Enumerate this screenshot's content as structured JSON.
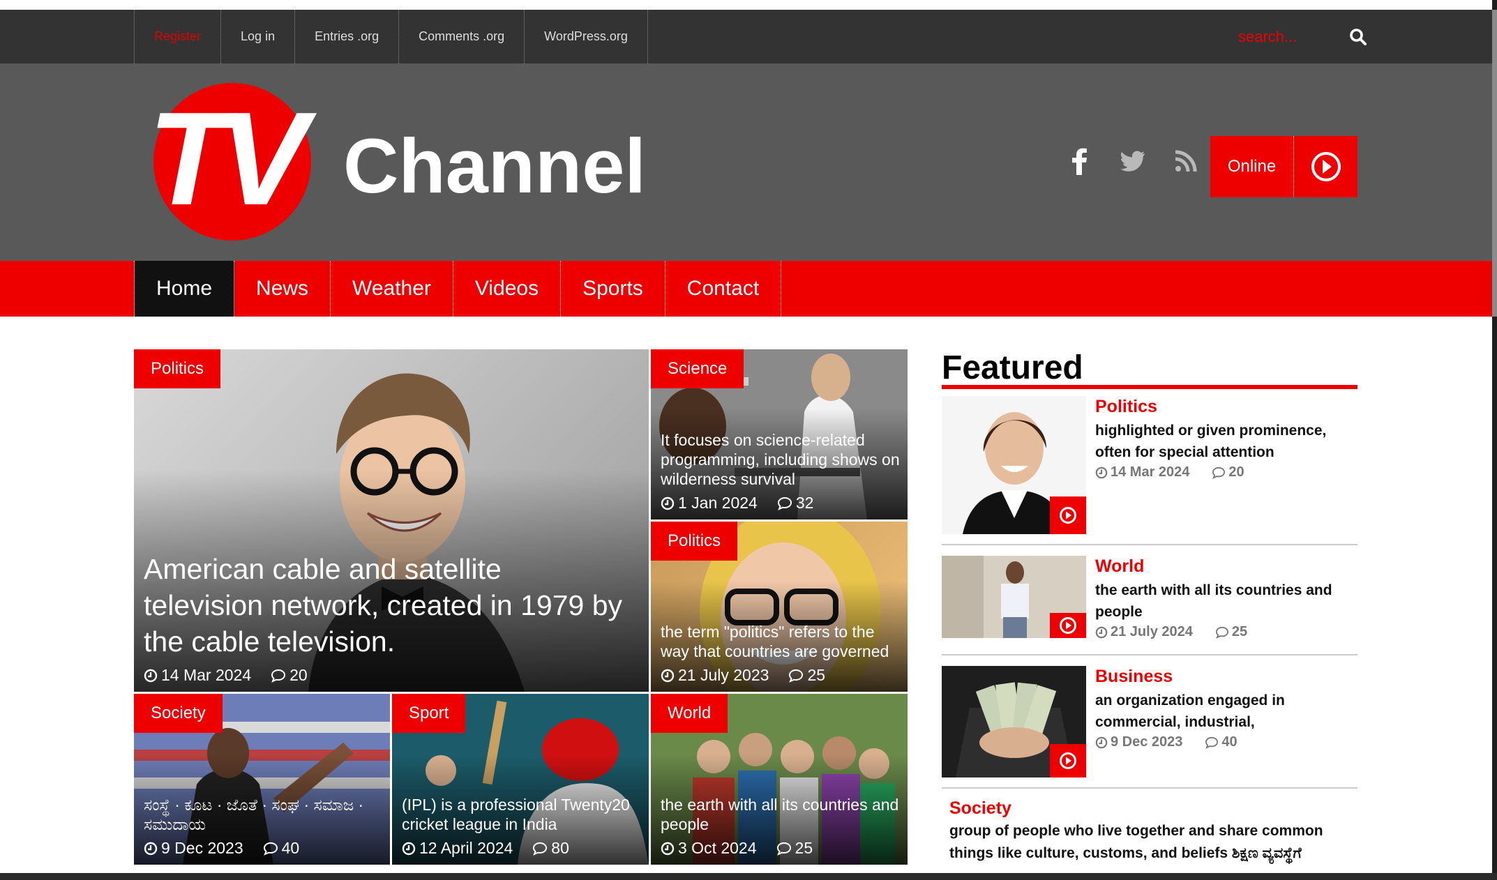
{
  "topbar": {
    "links": [
      "Register",
      "Log in",
      "Entries .org",
      "Comments .org",
      "WordPress.org"
    ],
    "search_placeholder": "search..."
  },
  "header": {
    "logo_text": "TV",
    "site_name": "Channel",
    "social": [
      "facebook-icon",
      "twitter-icon",
      "rss-icon"
    ],
    "online_label": "Online"
  },
  "nav": {
    "items": [
      "Home",
      "News",
      "Weather",
      "Videos",
      "Sports",
      "Contact"
    ],
    "active": "Home"
  },
  "grid": {
    "main": {
      "category": "Politics",
      "caption": "American cable and satellite television network, created in 1979 by the cable television.",
      "date": "14 Mar 2024",
      "comments": "20"
    },
    "science": {
      "category": "Science",
      "caption": "It focuses on science-related programming, including shows on wilderness survival",
      "date": "1 Jan 2024",
      "comments": "32"
    },
    "politics2": {
      "category": "Politics",
      "caption": "the term \"politics\" refers to the way that countries are governed",
      "date": "21 July 2023",
      "comments": "25"
    },
    "society": {
      "category": "Society",
      "caption": "ಸಂಸ್ಥೆ · ಕೂಟ · ಜೊತೆ · ಸಂಘ · ಸಮಾಜ · ಸಮುದಾಯ",
      "date": "9 Dec 2023",
      "comments": "40"
    },
    "sport": {
      "category": "Sport",
      "caption": "(IPL) is a professional Twenty20 cricket league in India",
      "date": "12 April 2024",
      "comments": "80"
    },
    "world": {
      "category": "World",
      "caption": "the earth with all its countries and people",
      "date": "3 Oct 2024",
      "comments": "25"
    }
  },
  "featured": {
    "title": "Featured",
    "items": [
      {
        "category": "Politics",
        "excerpt": "highlighted or given prominence, often for special attention",
        "date": "14 Mar 2024",
        "comments": "20"
      },
      {
        "category": "World",
        "excerpt": "the earth with all its countries and people",
        "date": "21 July 2024",
        "comments": "25"
      },
      {
        "category": "Business",
        "excerpt": "an organization engaged in commercial, industrial,",
        "date": "9 Dec 2023",
        "comments": "40"
      }
    ],
    "society": {
      "category": "Society",
      "text": "group of people who live together and share common things like culture, customs, and beliefs ಶಿಕ್ಷಣ ವ್ಯವಸ್ಥೆಗೆ"
    }
  },
  "colors": {
    "accent": "#e00000",
    "topbar": "#333333",
    "header": "#595959",
    "nav_active": "#111111"
  }
}
